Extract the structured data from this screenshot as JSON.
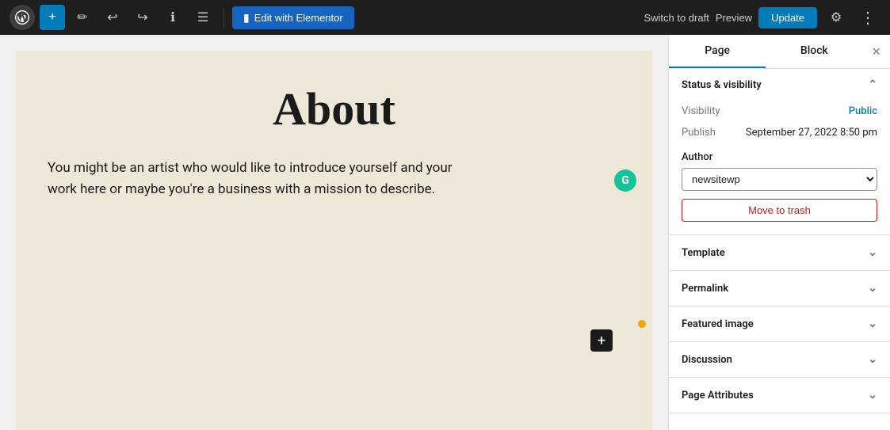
{
  "toolbar": {
    "add_label": "+",
    "edit_icon": "✏",
    "undo_icon": "↩",
    "redo_icon": "↪",
    "info_icon": "ℹ",
    "list_icon": "☰",
    "edit_elementor_label": "Edit with Elementor",
    "switch_draft_label": "Switch to draft",
    "preview_label": "Preview",
    "update_label": "Update",
    "gear_icon": "⚙",
    "more_icon": "⋮"
  },
  "canvas": {
    "page_title": "About",
    "page_body": "You might be an artist who would like to introduce yourself and your work here or maybe you're a business with a mission to describe.",
    "grammarly_letter": "G",
    "add_block_label": "+"
  },
  "sidebar": {
    "tab_page": "Page",
    "tab_block": "Block",
    "close_label": "×",
    "status_visibility": {
      "section_title": "Status & visibility",
      "visibility_label": "Visibility",
      "visibility_value": "Public",
      "publish_label": "Publish",
      "publish_value": "September 27, 2022 8:50 pm",
      "author_label": "Author",
      "author_value": "newsitewp",
      "move_trash_label": "Move to trash"
    },
    "template": {
      "section_title": "Template"
    },
    "permalink": {
      "section_title": "Permalink"
    },
    "featured_image": {
      "section_title": "Featured image"
    },
    "discussion": {
      "section_title": "Discussion"
    },
    "page_attributes": {
      "section_title": "Page Attributes"
    }
  }
}
